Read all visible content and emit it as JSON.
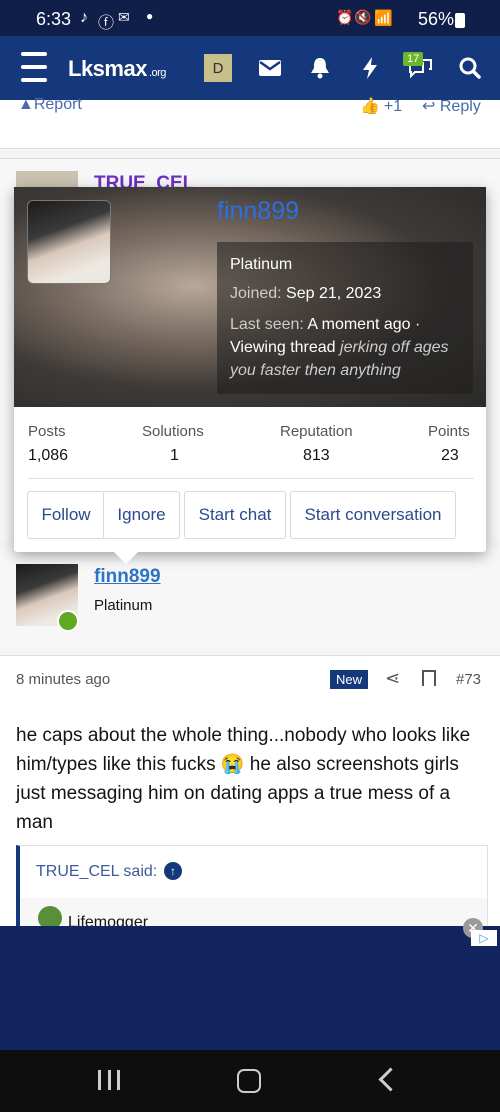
{
  "status": {
    "time": "6:33",
    "battery": "56%"
  },
  "nav": {
    "logo_main": "Lksmax",
    "logo_suffix": ".org",
    "user_initial": "D",
    "alerts_count": "17"
  },
  "prev_post": {
    "report": "Report",
    "like_count": "+1",
    "reply": "Reply"
  },
  "hidden_author": {
    "name": "TRUE_CEL"
  },
  "popup": {
    "username": "finn899",
    "title": "Platinum",
    "joined_label": "Joined:",
    "joined_value": "Sep 21, 2023",
    "lastseen_label": "Last seen:",
    "lastseen_value": "A moment ago",
    "activity": "Viewing thread",
    "activity_thread": "jerking off ages you faster then anything",
    "stats": [
      {
        "label": "Posts",
        "value": "1,086"
      },
      {
        "label": "Solutions",
        "value": "1"
      },
      {
        "label": "Reputation",
        "value": "813"
      },
      {
        "label": "Points",
        "value": "23"
      }
    ],
    "buttons": {
      "follow": "Follow",
      "ignore": "Ignore",
      "chat": "Start chat",
      "conversation": "Start conversation"
    }
  },
  "post": {
    "author": "finn899",
    "rank": "Platinum",
    "time": "8 minutes ago",
    "badge": "New",
    "number": "#73",
    "body_part1": "he caps about the whole thing...nobody who looks like him/types like this fucks ",
    "body_emoji": "😭",
    "body_part2": " he also screenshots girls just messaging him on dating apps a true mess of a man",
    "quote_author": "TRUE_CEL said:",
    "quote_inner": "Lifemogger"
  }
}
